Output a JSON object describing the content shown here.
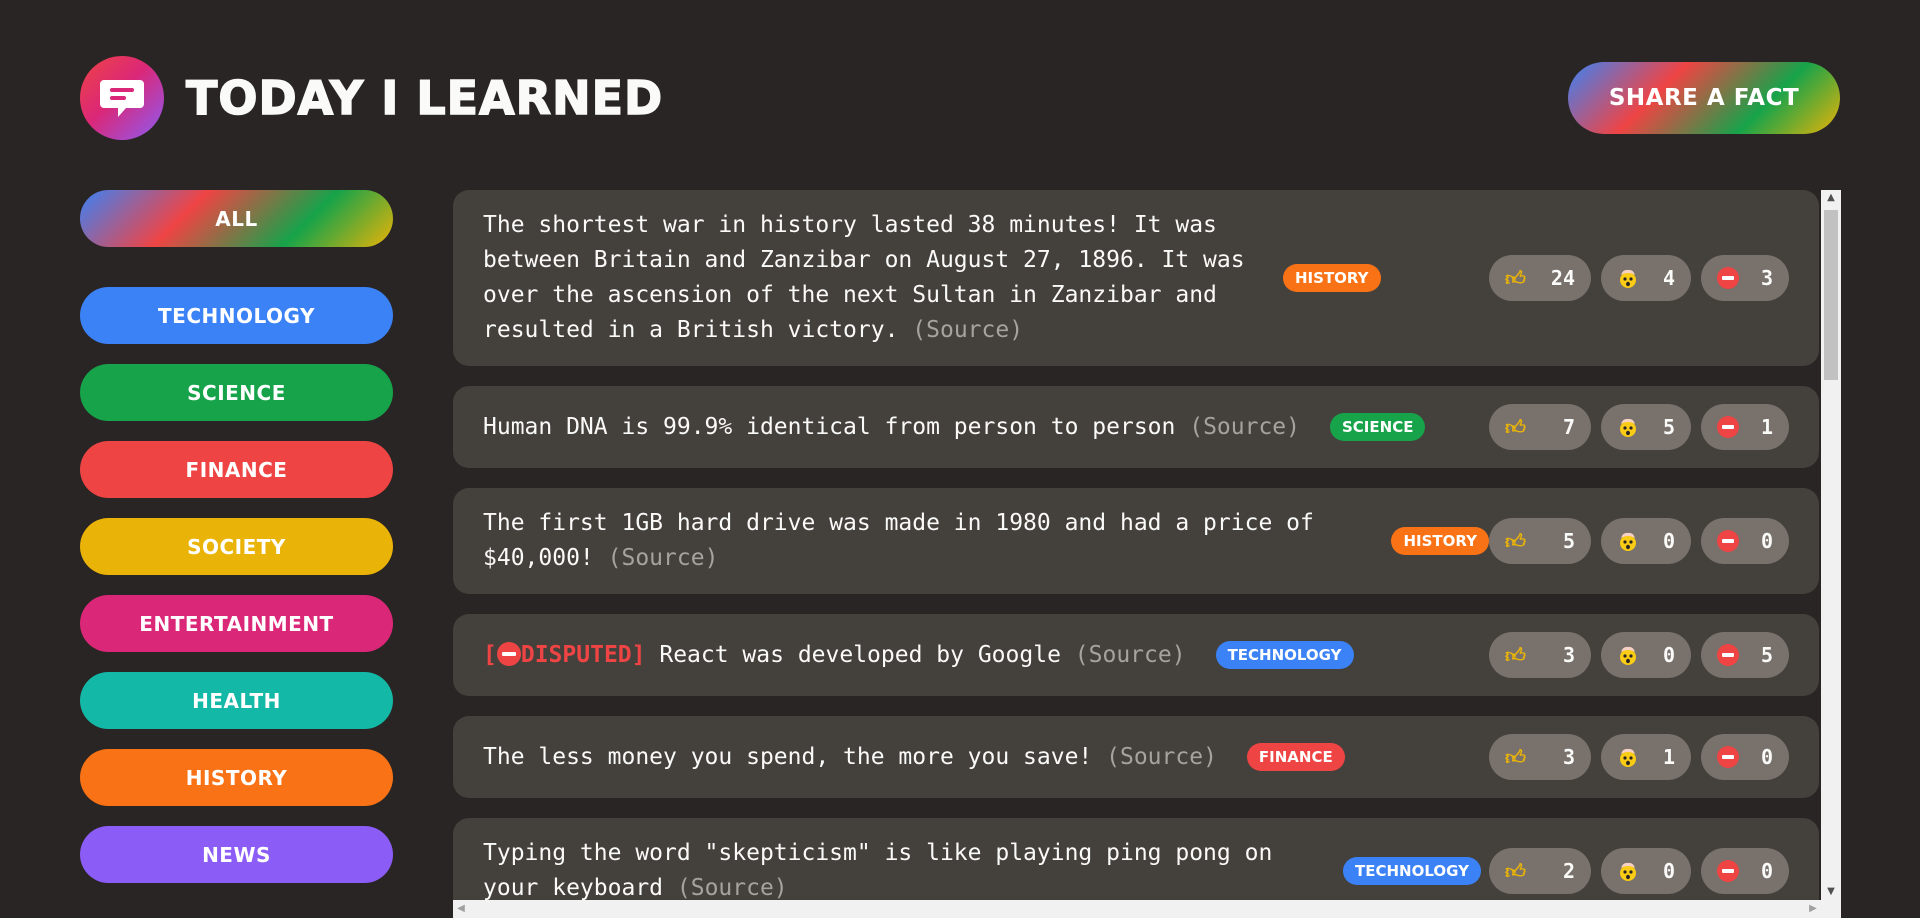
{
  "header": {
    "title": "Today I Learned",
    "logo_icon": "chat-bubble-icon",
    "share_label": "Share a fact"
  },
  "categories": [
    {
      "name": "all",
      "label": "All",
      "color": "gradient"
    },
    {
      "name": "technology",
      "label": "technology",
      "color": "#3b82f6"
    },
    {
      "name": "science",
      "label": "science",
      "color": "#16a34a"
    },
    {
      "name": "finance",
      "label": "finance",
      "color": "#ef4444"
    },
    {
      "name": "society",
      "label": "society",
      "color": "#eab308"
    },
    {
      "name": "entertainment",
      "label": "entertainment",
      "color": "#db2777"
    },
    {
      "name": "health",
      "label": "health",
      "color": "#14b8a6"
    },
    {
      "name": "history",
      "label": "history",
      "color": "#f97316"
    },
    {
      "name": "news",
      "label": "news",
      "color": "#8b5cf6"
    }
  ],
  "facts": [
    {
      "text": "The shortest war in history lasted 38 minutes! It was between Britain and Zanzibar on August 27, 1896. It was over the ascension of the next Sultan in Zanzibar and resulted in a British victory.",
      "source": "(Source)",
      "category": "history",
      "category_color": "#f97316",
      "disputed": false,
      "likes": "24",
      "mindblowing": "4",
      "false_votes": "3"
    },
    {
      "text": "Human DNA is 99.9% identical from person to person",
      "source": "(Source)",
      "category": "science",
      "category_color": "#16a34a",
      "disputed": false,
      "likes": "7",
      "mindblowing": "5",
      "false_votes": "1"
    },
    {
      "text": "The first 1GB hard drive was made in 1980 and had a price of $40,000!",
      "source": "(Source)",
      "category": "history",
      "category_color": "#f97316",
      "disputed": false,
      "likes": "5",
      "mindblowing": "0",
      "false_votes": "0"
    },
    {
      "text": "React was developed by Google",
      "source": "(Source)",
      "category": "technology",
      "category_color": "#3b82f6",
      "disputed": true,
      "disputed_label": "DISPUTED",
      "likes": "3",
      "mindblowing": "0",
      "false_votes": "5"
    },
    {
      "text": "The less money you spend, the more you save!",
      "source": "(Source)",
      "category": "finance",
      "category_color": "#ef4444",
      "disputed": false,
      "likes": "3",
      "mindblowing": "1",
      "false_votes": "0"
    },
    {
      "text": "Typing the word \"skepticism\" is like playing ping pong on your keyboard",
      "source": "(Source)",
      "category": "technology",
      "category_color": "#3b82f6",
      "disputed": false,
      "likes": "2",
      "mindblowing": "0",
      "false_votes": "0"
    }
  ],
  "icons": {
    "like": "thumbs-up-icon",
    "mindblowing": "mind-blown-icon",
    "false": "no-entry-icon"
  }
}
